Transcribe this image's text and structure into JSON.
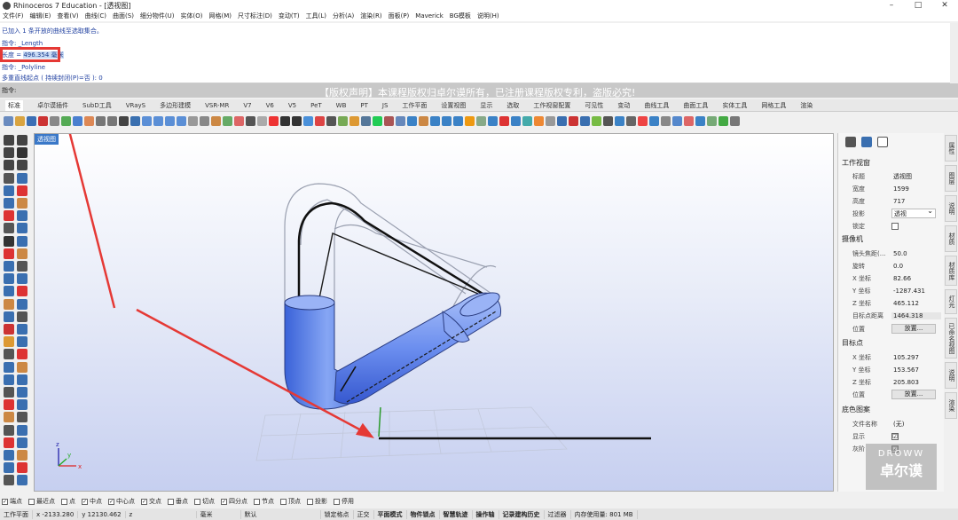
{
  "window": {
    "title": "Rhinoceros 7 Education - [透视图]",
    "controls": [
      "–",
      "□",
      "✕"
    ]
  },
  "menu": [
    "文件(F)",
    "编辑(E)",
    "查看(V)",
    "曲线(C)",
    "曲面(S)",
    "细分物件(U)",
    "实体(O)",
    "网格(M)",
    "尺寸标注(D)",
    "变动(T)",
    "工具(L)",
    "分析(A)",
    "渲染(R)",
    "面板(P)",
    "Maverick",
    "BG模板",
    "说明(H)"
  ],
  "command_history": {
    "line1": "已加入 1 条开放的曲线至选取集合。",
    "line2": "指令: _Length",
    "line3_prefix": "长度 = ",
    "line3_value": "496.354 毫米",
    "line4": "指令: _Polyline",
    "line5": "多重直线起点 ( 持续封闭(P)=否 ):  0"
  },
  "command_prompt": {
    "label": "指令:",
    "notice": "【版权声明】本课程版权归卓尔谟所有，已注册课程版权专利，盗版必究!"
  },
  "tabs": [
    "标准",
    "卓尔谟插件",
    "SubD工具",
    "VRayS",
    "多边形建模",
    "VSR-MR",
    "V7",
    "V6",
    "V5",
    "PeT",
    "WB",
    "PT",
    "JS",
    "工作平面",
    "设置视图",
    "显示",
    "选取",
    "工作视窗配置",
    "可见性",
    "变动",
    "曲线工具",
    "曲面工具",
    "实体工具",
    "网格工具",
    "渲染"
  ],
  "viewport": {
    "label": "透视图"
  },
  "properties": {
    "section_viewport": "工作视窗",
    "rows_viewport": [
      {
        "k": "标题",
        "v": "透视图"
      },
      {
        "k": "宽度",
        "v": "1599"
      },
      {
        "k": "高度",
        "v": "717"
      },
      {
        "k": "投影",
        "v": "透视"
      },
      {
        "k": "锁定",
        "v": ""
      }
    ],
    "section_camera": "摄像机",
    "rows_camera": [
      {
        "k": "镜头焦距(...",
        "v": "50.0"
      },
      {
        "k": "旋转",
        "v": "0.0"
      },
      {
        "k": "X 坐标",
        "v": "82.66"
      },
      {
        "k": "Y 坐标",
        "v": "-1287.431"
      },
      {
        "k": "Z 坐标",
        "v": "465.112"
      },
      {
        "k": "目标点距离",
        "v": "1464.318"
      },
      {
        "k": "位置",
        "v": "放置..."
      }
    ],
    "section_target": "目标点",
    "rows_target": [
      {
        "k": "X 坐标",
        "v": "105.297"
      },
      {
        "k": "Y 坐标",
        "v": "153.567"
      },
      {
        "k": "Z 坐标",
        "v": "205.803"
      },
      {
        "k": "位置",
        "v": "放置..."
      }
    ],
    "section_bg": "底色图案",
    "rows_bg": [
      {
        "k": "文件名称",
        "v": "(无)"
      },
      {
        "k": "显示",
        "v": "☑"
      },
      {
        "k": "灰阶",
        "v": "☑"
      }
    ]
  },
  "right_tabs": [
    "属性",
    "图层",
    "说明",
    "材质",
    "材质库",
    "灯光",
    "已命名视图",
    "说明",
    "渲染"
  ],
  "osnap": [
    {
      "label": "端点",
      "on": true
    },
    {
      "label": "最近点",
      "on": false
    },
    {
      "label": "点",
      "on": false
    },
    {
      "label": "中点",
      "on": true
    },
    {
      "label": "中心点",
      "on": true
    },
    {
      "label": "交点",
      "on": true
    },
    {
      "label": "垂点",
      "on": false
    },
    {
      "label": "切点",
      "on": false
    },
    {
      "label": "四分点",
      "on": true
    },
    {
      "label": "节点",
      "on": false
    },
    {
      "label": "顶点",
      "on": false
    },
    {
      "label": "投影",
      "on": false
    },
    {
      "label": "停用",
      "on": false
    }
  ],
  "status": {
    "cplane": "工作平面",
    "x": "x -2133.280",
    "y": "y 12130.462",
    "z": "z",
    "unit": "毫米",
    "layer": "默认",
    "toggles": [
      "锁定格点",
      "正交",
      "平面模式",
      "物件锁点",
      "智慧轨迹",
      "操作轴",
      "记录建构历史",
      "过滤器",
      "内存使用量: 801 MB"
    ]
  },
  "watermark": {
    "top": "DROWW",
    "bottom": "卓尔谟"
  },
  "axes": {
    "x": "x",
    "y": "y",
    "z": "z"
  }
}
